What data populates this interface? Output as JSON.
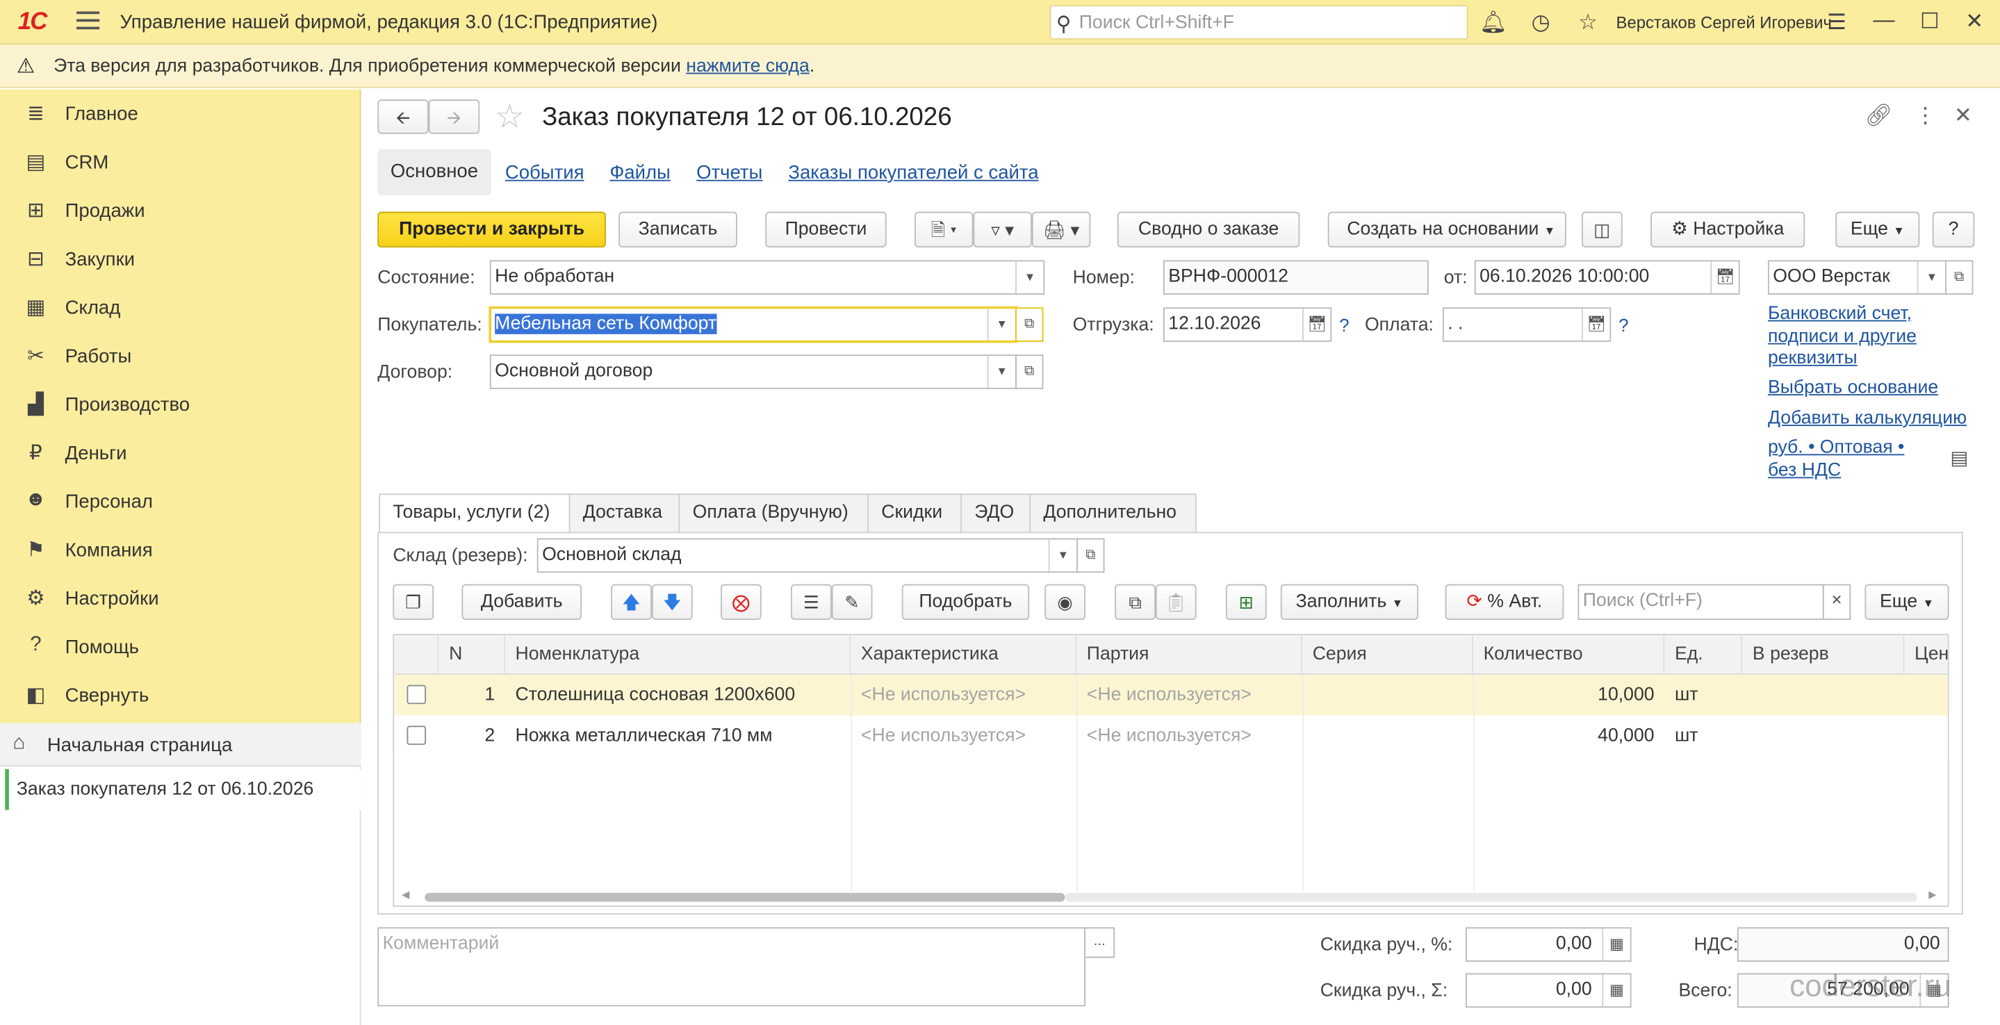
{
  "titlebar": {
    "logo": "1С",
    "app_title": "Управление нашей фирмой, редакция 3.0  (1С:Предприятие)",
    "search_placeholder": "Поиск Ctrl+Shift+F",
    "user_name": "Верстаков Сергей Игоревич"
  },
  "banner": {
    "text": "Эта версия для разработчиков. Для приобретения коммерческой версии ",
    "link": "нажмите сюда",
    "tail": "."
  },
  "sidebar": {
    "items": [
      {
        "label": "Главное",
        "icon": "≣"
      },
      {
        "label": "CRM",
        "icon": "▤"
      },
      {
        "label": "Продажи",
        "icon": "⊞"
      },
      {
        "label": "Закупки",
        "icon": "⊟"
      },
      {
        "label": "Склад",
        "icon": "▦"
      },
      {
        "label": "Работы",
        "icon": "✂"
      },
      {
        "label": "Производство",
        "icon": "▟"
      },
      {
        "label": "Деньги",
        "icon": "₽"
      },
      {
        "label": "Персонал",
        "icon": "☻"
      },
      {
        "label": "Компания",
        "icon": "⚑"
      },
      {
        "label": "Настройки",
        "icon": "⚙"
      },
      {
        "label": "Помощь",
        "icon": "?"
      },
      {
        "label": "Свернуть",
        "icon": "◧"
      }
    ],
    "home": "Начальная страница",
    "open_doc": "Заказ покупателя 12 от 06.10.2026"
  },
  "doc": {
    "title": "Заказ покупателя 12 от 06.10.2026",
    "nav_tabs": [
      "Основное",
      "События",
      "Файлы",
      "Отчеты",
      "Заказы покупателей с сайта"
    ],
    "toolbar": {
      "post_close": "Провести и закрыть",
      "save": "Записать",
      "post": "Провести",
      "summary": "Сводно о заказе",
      "create_based": "Создать на основании",
      "settings": "Настройка",
      "more": "Еще",
      "help": "?"
    },
    "fields": {
      "state_label": "Состояние:",
      "state_value": "Не обработан",
      "buyer_label": "Покупатель:",
      "buyer_value": "Мебельная сеть Комфорт",
      "contract_label": "Договор:",
      "contract_value": "Основной договор",
      "number_label": "Номер:",
      "number_value": "ВРНФ-000012",
      "from_label": "от:",
      "from_value": "06.10.2026 10:00:00",
      "org_value": "ООО Верстак",
      "shipment_label": "Отгрузка:",
      "shipment_value": "12.10.2026",
      "payment_label": "Оплата:",
      "payment_value": " .  .",
      "q": "?"
    },
    "right_links": {
      "bank": "Банковский счет, подписи и другие реквизиты",
      "choose_basis": "Выбрать основание",
      "add_calc": "Добавить калькуляцию",
      "currency": "руб. • Оптовая • без НДС"
    },
    "tabs": [
      "Товары, услуги (2)",
      "Доставка",
      "Оплата (Вручную)",
      "Скидки",
      "ЭДО",
      "Дополнительно"
    ],
    "warehouse_label": "Склад (резерв):",
    "warehouse_value": "Основной склад",
    "table_toolbar": {
      "add": "Добавить",
      "pick": "Подобрать",
      "fill": "Заполнить",
      "auto_percent": "% Авт.",
      "search_placeholder": "Поиск (Ctrl+F)",
      "more": "Еще"
    },
    "table": {
      "columns": [
        "N",
        "Номенклатура",
        "Характеристика",
        "Партия",
        "Серия",
        "Количество",
        "Ед.",
        "В резерв",
        "Цен"
      ],
      "rows": [
        {
          "n": "1",
          "item": "Столешница сосновая 1200х600",
          "char": "<Не используется>",
          "batch": "<Не используется>",
          "series": "",
          "qty": "10,000",
          "unit": "шт",
          "reserve": ""
        },
        {
          "n": "2",
          "item": "Ножка металлическая 710 мм",
          "char": "<Не используется>",
          "batch": "<Не используется>",
          "series": "",
          "qty": "40,000",
          "unit": "шт",
          "reserve": ""
        }
      ]
    },
    "footer": {
      "comment_placeholder": "Комментарий",
      "comment_more": "...",
      "disc_pct_label": "Скидка руч., %:",
      "disc_pct_value": "0,00",
      "disc_sum_label": "Скидка руч., Σ:",
      "disc_sum_value": "0,00",
      "vat_label": "НДС:",
      "vat_value": "0,00",
      "total_label": "Всего:",
      "total_value": "57 200,00",
      "watermark": "coderster.ru"
    }
  }
}
